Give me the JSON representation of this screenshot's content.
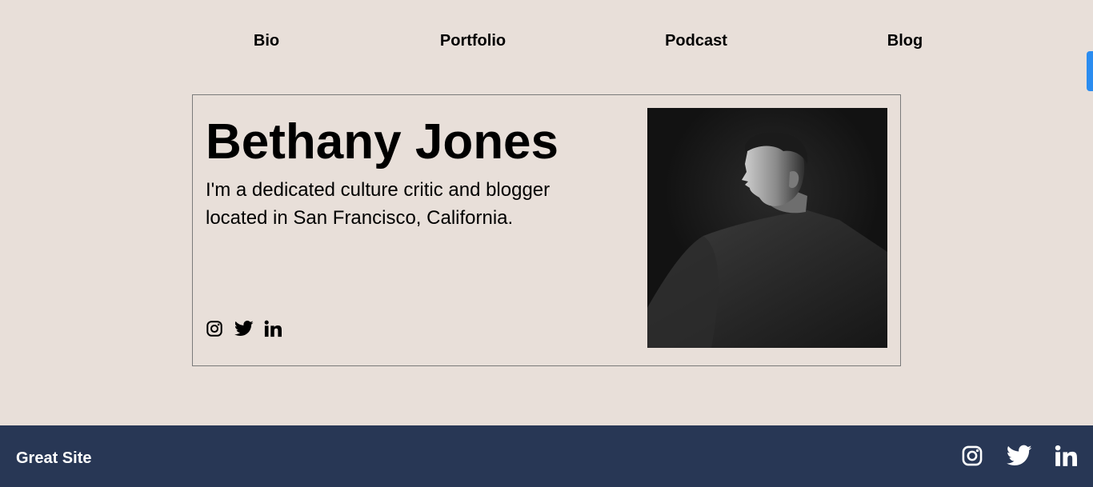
{
  "nav": {
    "items": [
      {
        "label": "Bio"
      },
      {
        "label": "Portfolio"
      },
      {
        "label": "Podcast"
      },
      {
        "label": "Blog"
      }
    ]
  },
  "profile": {
    "name": "Bethany Jones",
    "description": "I'm a dedicated culture critic and blogger located in San Francisco, California.",
    "social_icons": [
      "instagram-icon",
      "twitter-icon",
      "linkedin-icon"
    ],
    "photo_icon": "portrait-photo"
  },
  "footer": {
    "brand": "Great Site",
    "social_icons": [
      "instagram-icon",
      "twitter-icon",
      "linkedin-icon"
    ]
  },
  "colors": {
    "page_background": "#e8dfd9",
    "footer_background": "#283755",
    "accent_tab": "#2a8cf0"
  }
}
